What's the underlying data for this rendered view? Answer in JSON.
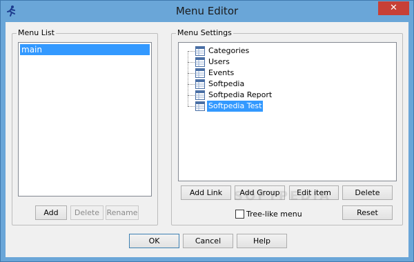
{
  "window": {
    "title": "Menu Editor",
    "close_glyph": "✕",
    "app_icon": "runner-icon"
  },
  "menu_list": {
    "label": "Menu List",
    "items": [
      "main"
    ],
    "buttons": {
      "add": "Add",
      "delete": "Delete",
      "rename": "Rename"
    }
  },
  "menu_settings": {
    "label": "Menu Settings",
    "tree": [
      {
        "label": "Categories",
        "icon": "table-icon",
        "selected": false
      },
      {
        "label": "Users",
        "icon": "table-icon",
        "selected": false
      },
      {
        "label": "Events",
        "icon": "table-icon",
        "selected": false
      },
      {
        "label": "Softpedia",
        "icon": "table-icon",
        "selected": false
      },
      {
        "label": "Softpedia Report",
        "icon": "table-icon",
        "selected": false
      },
      {
        "label": "Softpedia Test",
        "icon": "table-icon",
        "selected": true
      }
    ],
    "buttons": {
      "add_link": "Add Link",
      "add_group": "Add Group",
      "edit_item": "Edit item",
      "delete": "Delete",
      "reset": "Reset"
    },
    "tree_like_label": "Tree-like  menu",
    "tree_like_checked": false
  },
  "footer": {
    "ok": "OK",
    "cancel": "Cancel",
    "help": "Help"
  },
  "watermark": "SOFTPEDIA",
  "colors": {
    "titlebar": "#6aa6d8",
    "selection": "#3399ff",
    "close": "#c74036"
  }
}
